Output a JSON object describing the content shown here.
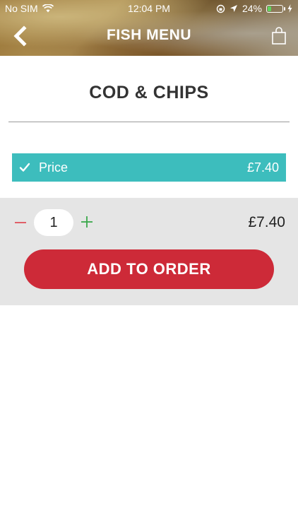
{
  "status_bar": {
    "carrier": "No SIM",
    "time": "12:04 PM",
    "battery_percent": "24%",
    "battery_level": 0.24,
    "icons": [
      "wifi-icon",
      "rotation-lock-icon",
      "location-arrow-icon",
      "battery-icon",
      "charging-bolt-icon"
    ]
  },
  "nav": {
    "title": "FISH MENU",
    "back_icon": "chevron-left-icon",
    "cart_icon": "shopping-bag-icon"
  },
  "product": {
    "name": "COD & CHIPS"
  },
  "options": [
    {
      "label": "Price",
      "price": "£7.40",
      "selected": true
    }
  ],
  "order": {
    "quantity": "1",
    "total": "£7.40",
    "add_label": "ADD TO ORDER"
  },
  "colors": {
    "option_bg": "#3dbdbd",
    "button_bg": "#cd2a38",
    "minus_color": "#e0505a",
    "plus_color": "#3aa84a",
    "panel_bg": "#e5e5e5"
  }
}
